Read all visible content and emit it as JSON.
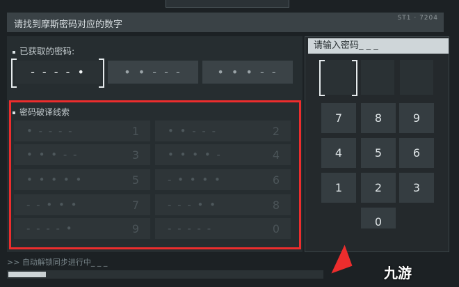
{
  "title": "请找到摩斯密码对应的数字",
  "title_meta": "ST1 · 7204",
  "obtained_label": "已获取的密码:",
  "obtained_codes": [
    "- - - - •",
    "• • - - -",
    "• • • - -"
  ],
  "clue_label": "密码破译线索",
  "clues": [
    {
      "code": "• - - - -",
      "num": "1"
    },
    {
      "code": "• • - - -",
      "num": "2"
    },
    {
      "code": "• • • - -",
      "num": "3"
    },
    {
      "code": "• • • • -",
      "num": "4"
    },
    {
      "code": "• • • • •",
      "num": "5"
    },
    {
      "code": "- • • • •",
      "num": "6"
    },
    {
      "code": "- - • • •",
      "num": "7"
    },
    {
      "code": "- - - • •",
      "num": "8"
    },
    {
      "code": "- - - - •",
      "num": "9"
    },
    {
      "code": "- - - - -",
      "num": "0"
    }
  ],
  "password_prompt": "请输入密码_ _ _",
  "keypad": [
    "7",
    "8",
    "9",
    "4",
    "5",
    "6",
    "1",
    "2",
    "3",
    "0"
  ],
  "status": ">> 自动解锁同步进行中_ _ _",
  "watermark": "九游",
  "colors": {
    "highlight": "#ec2d2d",
    "panel": "#262d30"
  }
}
